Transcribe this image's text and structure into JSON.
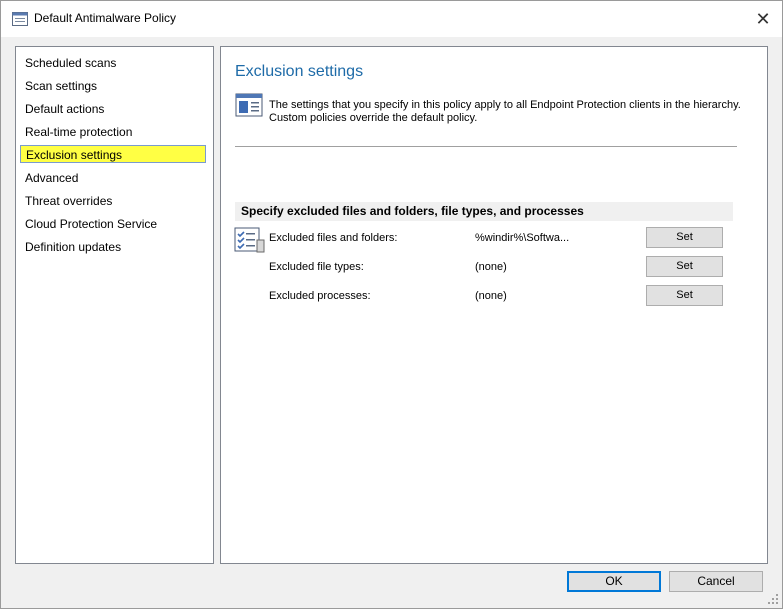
{
  "window": {
    "title": "Default Antimalware Policy",
    "close_glyph": "✕"
  },
  "nav": {
    "items": [
      {
        "label": "Scheduled scans"
      },
      {
        "label": "Scan settings"
      },
      {
        "label": "Default actions"
      },
      {
        "label": "Real-time protection"
      },
      {
        "label": "Exclusion settings",
        "selected": true
      },
      {
        "label": "Advanced"
      },
      {
        "label": "Threat overrides"
      },
      {
        "label": "Cloud Protection Service"
      },
      {
        "label": "Definition updates"
      }
    ]
  },
  "content": {
    "title": "Exclusion settings",
    "info_text": "The settings that you specify in this policy apply to all Endpoint Protection clients in the hierarchy. Custom policies override the default policy.",
    "section_header": "Specify excluded files and folders, file types, and processes",
    "rows": [
      {
        "label": "Excluded files and folders:",
        "value": "%windir%\\Softwa...",
        "button": "Set"
      },
      {
        "label": "Excluded file types:",
        "value": "(none)",
        "button": "Set"
      },
      {
        "label": "Excluded processes:",
        "value": "(none)",
        "button": "Set"
      }
    ]
  },
  "footer": {
    "ok_label": "OK",
    "cancel_label": "Cancel"
  },
  "colors": {
    "title_blue": "#1e6ba8",
    "highlight": "#ffff44",
    "focus_border": "#0078d7"
  },
  "icons": {
    "window": "policy-window-icon",
    "info": "info-document-icon",
    "checklist": "checklist-icon",
    "close": "close-icon",
    "grip": "resize-grip-icon"
  }
}
